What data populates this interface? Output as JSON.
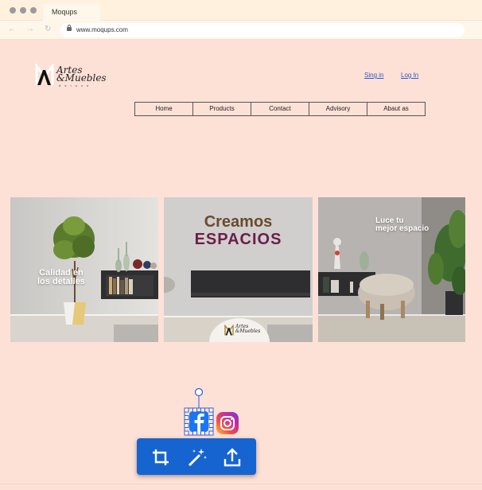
{
  "browser": {
    "tab_title": "Moqups",
    "url": "www.moqups.com"
  },
  "brand": {
    "line1": "Artes",
    "line2": "&Muebles",
    "tagline": "d e l u x e"
  },
  "auth": {
    "sign_in": "Sing in",
    "log_in": "Log In"
  },
  "nav": {
    "items": [
      "Home",
      "Products",
      "Contact",
      "Advisory",
      "Abaut as"
    ]
  },
  "banners": {
    "left_caption_1": "Calidad en",
    "left_caption_2": "los detalles",
    "center_title_1": "Creamos",
    "center_title_2": "ESPACIOS",
    "center_badge_1": "Artes",
    "center_badge_2": "&Muebles",
    "right_caption_1": "Luce tu",
    "right_caption_2": "mejor espacio"
  },
  "colors": {
    "page_bg": "#fde1d7",
    "toolbar_bg": "#1664d0",
    "link": "#3355cc",
    "creamos": "#6a4a2e",
    "espacios": "#6b1e48"
  },
  "social": {
    "facebook_icon": "facebook-icon",
    "instagram_icon": "instagram-icon"
  },
  "toolbar": {
    "crop_icon": "crop-icon",
    "magic_icon": "magic-wand-icon",
    "share_icon": "share-upload-icon"
  }
}
